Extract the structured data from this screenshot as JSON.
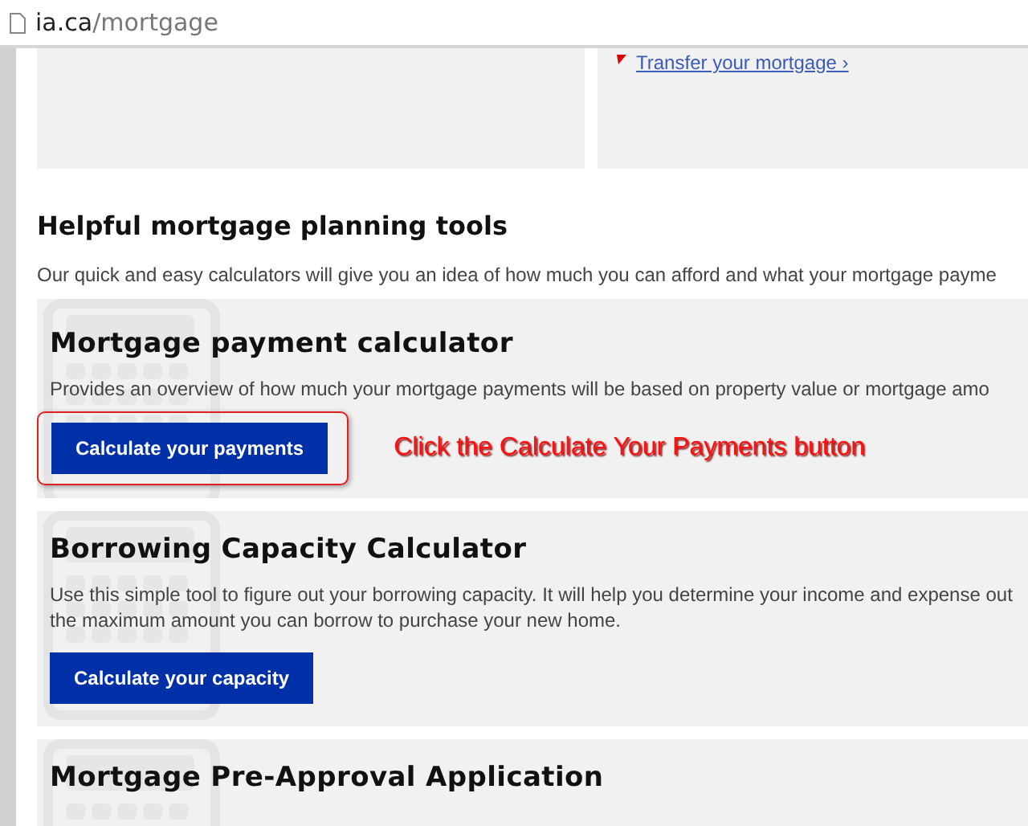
{
  "address_bar": {
    "url_host": "ia.ca",
    "url_path": "/mortgage"
  },
  "top_link": {
    "label": "Transfer your mortgage",
    "chevron": "›"
  },
  "section": {
    "title": "Helpful mortgage planning tools",
    "intro": "Our quick and easy calculators will give you an idea of how much you can afford and what your mortgage payme"
  },
  "cards": [
    {
      "title": "Mortgage payment calculator",
      "description": "Provides an overview of how much your mortgage payments will be based on property value or mortgage amo",
      "button": "Calculate your payments",
      "annotation": {
        "text": "Click the Calculate Your Payments button"
      }
    },
    {
      "title": "Borrowing Capacity Calculator",
      "description": "Use this simple tool to figure out your borrowing capacity. It will help you determine your income and expense out the maximum amount you can borrow to purchase your new home.",
      "button": "Calculate your capacity"
    },
    {
      "title": "Mortgage Pre-Approval Application"
    }
  ]
}
